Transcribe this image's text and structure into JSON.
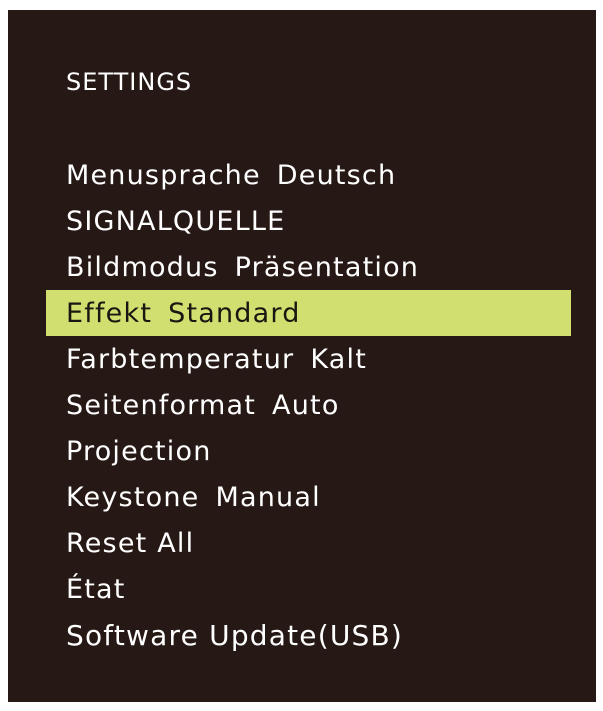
{
  "title": "SETTINGS",
  "menu": {
    "selected_index": 3,
    "items": [
      {
        "label": "Menusprache",
        "value": "Deutsch"
      },
      {
        "label": "SIGNALQUELLE",
        "value": ""
      },
      {
        "label": "Bildmodus",
        "value": "Präsentation"
      },
      {
        "label": "Effekt",
        "value": "Standard"
      },
      {
        "label": "Farbtemperatur",
        "value": "Kalt"
      },
      {
        "label": "Seitenformat",
        "value": "Auto"
      },
      {
        "label": "Projection",
        "value": ""
      },
      {
        "label": "Keystone",
        "value": "Manual"
      },
      {
        "label": "Reset All",
        "value": ""
      },
      {
        "label": "État",
        "value": ""
      },
      {
        "label": "Software Update(USB)",
        "value": ""
      }
    ]
  },
  "colors": {
    "background": "#261814",
    "highlight": "#d0df70",
    "text": "#ffffff"
  }
}
